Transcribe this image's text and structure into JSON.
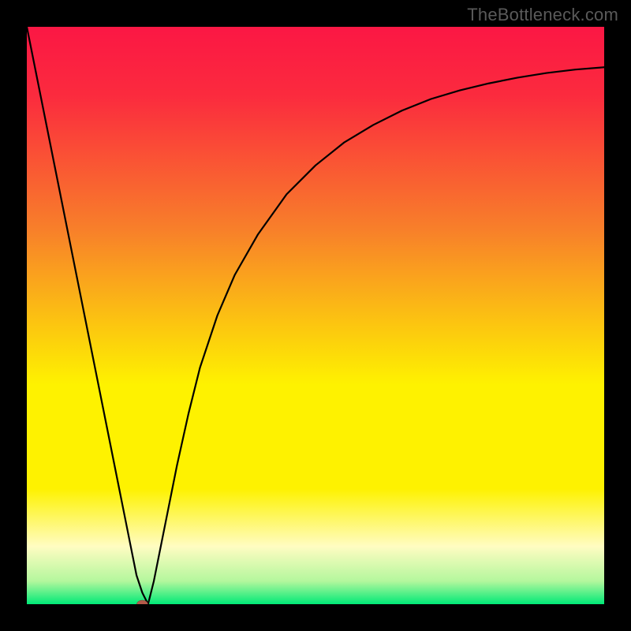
{
  "watermark": "TheBottleneck.com",
  "chart_data": {
    "type": "line",
    "title": "",
    "xlabel": "",
    "ylabel": "",
    "xlim": [
      0,
      100
    ],
    "ylim": [
      0,
      100
    ],
    "background_gradient": {
      "top": "#fb1744",
      "mid_upper": "#f87f2a",
      "mid": "#fef200",
      "lower": "#fffcc2",
      "bottom": "#00e977"
    },
    "series": [
      {
        "name": "bottleneck-curve",
        "color": "#000000",
        "x": [
          0,
          2,
          4,
          6,
          8,
          10,
          12,
          14,
          16,
          18,
          19,
          20,
          21,
          22,
          24,
          26,
          28,
          30,
          33,
          36,
          40,
          45,
          50,
          55,
          60,
          65,
          70,
          75,
          80,
          85,
          90,
          95,
          100
        ],
        "y": [
          100,
          90,
          80,
          70,
          60,
          50,
          40,
          30,
          20,
          10,
          5,
          2,
          0,
          4,
          14,
          24,
          33,
          41,
          50,
          57,
          64,
          71,
          76,
          80,
          83,
          85.5,
          87.5,
          89,
          90.2,
          91.2,
          92,
          92.6,
          93
        ]
      }
    ],
    "marker": {
      "name": "bottleneck-point",
      "x": 20,
      "y": 0,
      "color": "#b35a4a",
      "rx": 7,
      "ry": 5
    }
  }
}
